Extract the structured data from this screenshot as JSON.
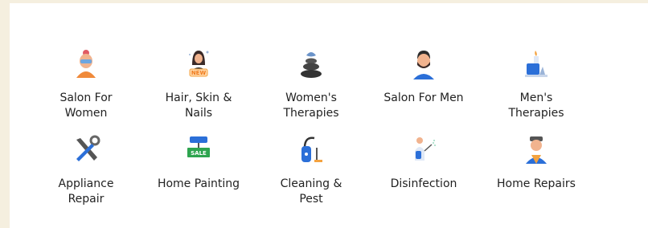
{
  "services": [
    {
      "label": "Salon For Women",
      "icon": "woman-facial-icon"
    },
    {
      "label": "Hair, Skin & Nails",
      "icon": "woman-new-icon",
      "badge": "NEW"
    },
    {
      "label": "Women's Therapies",
      "icon": "stones-icon"
    },
    {
      "label": "Salon For Men",
      "icon": "man-beard-icon"
    },
    {
      "label": "Men's Therapies",
      "icon": "candle-icon"
    },
    {
      "label": "Appliance Repair",
      "icon": "tools-icon"
    },
    {
      "label": "Home Painting",
      "icon": "paint-roller-icon",
      "badge": "SALE"
    },
    {
      "label": "Cleaning & Pest",
      "icon": "vacuum-icon"
    },
    {
      "label": "Disinfection",
      "icon": "sprayer-icon"
    },
    {
      "label": "Home Repairs",
      "icon": "repairman-icon"
    }
  ],
  "colors": {
    "page_background": "#f5efdf",
    "card_background": "#ffffff",
    "text": "#222222",
    "accent_orange": "#f4a340",
    "accent_blue": "#2b6fd8",
    "sale_green": "#2ea44f"
  }
}
